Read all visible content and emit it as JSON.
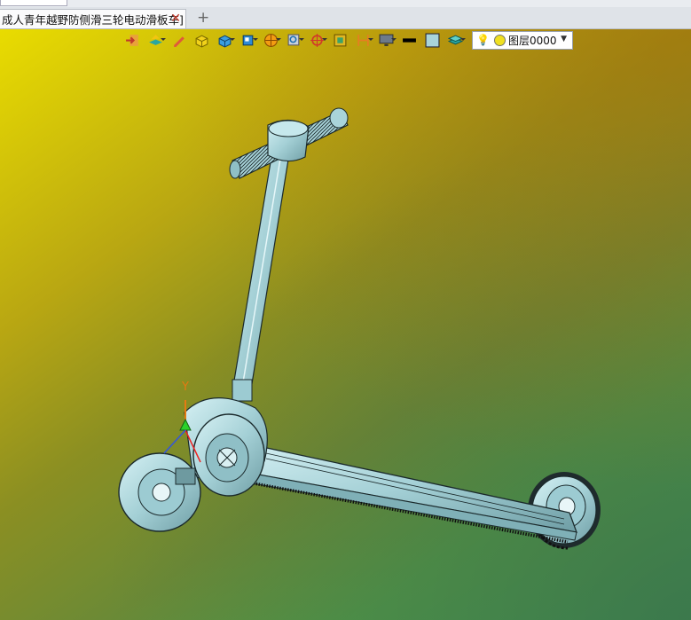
{
  "document_tab": {
    "title": "成人青年越野防侧滑三轮电动滑板车]",
    "close_symbol": "✕"
  },
  "new_tab_symbol": "+",
  "toolbar": {
    "icons": [
      "exit-sketch-icon",
      "layer-stack-icon",
      "pencil-icon",
      "cube-yellow-icon",
      "cube-blue-icon",
      "view-cube-icon",
      "sphere-orange-icon",
      "zoom-icon",
      "axis-target-icon",
      "render-box-icon",
      "dimension-icon",
      "monitor-icon",
      "line-weight-icon",
      "color-swatch-icon",
      "layers-icon"
    ]
  },
  "layer_selector": {
    "bulb": "💡",
    "value": "图层0000",
    "arrow": "▼"
  },
  "triad": {
    "y_label": "Y"
  },
  "colors": {
    "model": "#a9d4da",
    "model_edge": "#1b2a2c",
    "bg_top": "#e9dc00",
    "bg_bottom": "#3b9a5a",
    "accent_orange": "#e47a12"
  }
}
